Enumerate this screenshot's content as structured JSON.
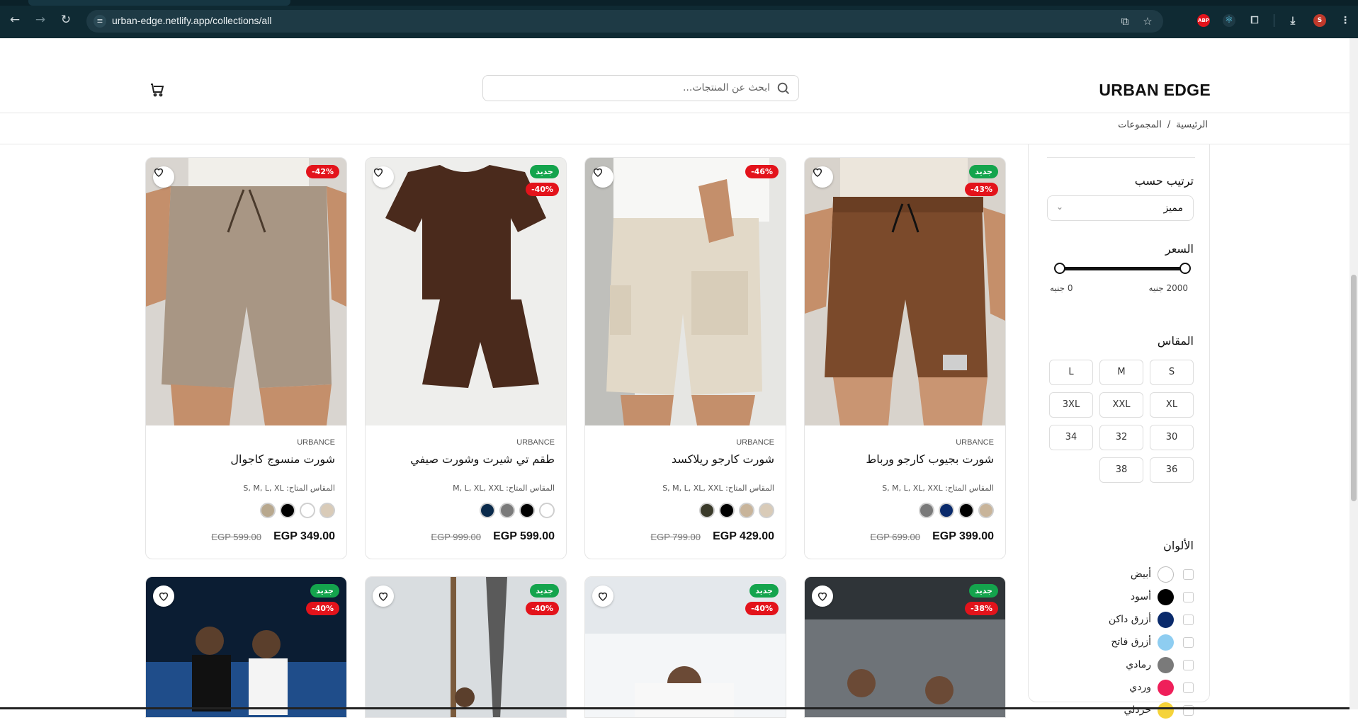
{
  "browser": {
    "url": "urban-edge.netlify.app/collections/all",
    "profile_initial": "S"
  },
  "header": {
    "logo": "URBAN EDGE",
    "search_placeholder": "ابحث عن المنتجات..."
  },
  "breadcrumb": {
    "home": "الرئيسية",
    "separator": "/",
    "current": "المجموعات"
  },
  "filters": {
    "sort_title": "ترتيب حسب",
    "sort_value": "مميز",
    "price_title": "السعر",
    "price_min_label": "0 جنيه",
    "price_max_label": "2000 جنيه",
    "size_title": "المقاس",
    "sizes": [
      "S",
      "M",
      "L",
      "XL",
      "XXL",
      "3XL",
      "30",
      "32",
      "34",
      "36",
      "38"
    ],
    "colors_title": "الألوان",
    "colors": [
      {
        "name": "أبيض",
        "hex": "#ffffff"
      },
      {
        "name": "أسود",
        "hex": "#000000"
      },
      {
        "name": "أزرق داكن",
        "hex": "#0a2a6b"
      },
      {
        "name": "أزرق فاتح",
        "hex": "#8ecdf1"
      },
      {
        "name": "رمادي",
        "hex": "#7a7a7a"
      },
      {
        "name": "وردي",
        "hex": "#ef1f5a"
      },
      {
        "name": "خردلي",
        "hex": "#f5d33a"
      }
    ]
  },
  "products": [
    {
      "brand": "URBANCE",
      "name": "شورت بجيوب كارجو ورباط",
      "sizes_label": "المقاس المتاح: S, M, L, XL, XXL",
      "colors": [
        "#c8b49a",
        "#000000",
        "#0a2a6b",
        "#7a7a7a"
      ],
      "price": "EGP 399.00",
      "old_price": "EGP 699.00",
      "badge_new": "جديد",
      "badge_discount": "-43%"
    },
    {
      "brand": "URBANCE",
      "name": "شورت كارجو ريلاكسد",
      "sizes_label": "المقاس المتاح: S, M, L, XL, XXL",
      "colors": [
        "#d9cbb8",
        "#c8b49a",
        "#000000",
        "#3a3a2a"
      ],
      "price": "EGP 429.00",
      "old_price": "EGP 799.00",
      "badge_new": "",
      "badge_discount": "-46%"
    },
    {
      "brand": "URBANCE",
      "name": "طقم تي شيرت وشورت صيفي",
      "sizes_label": "المقاس المتاح: M, L, XL, XXL",
      "colors": [
        "#ffffff",
        "#000000",
        "#7a7a7a",
        "#0a2a4b"
      ],
      "price": "EGP 599.00",
      "old_price": "EGP 999.00",
      "badge_new": "جديد",
      "badge_discount": "-40%"
    },
    {
      "brand": "URBANCE",
      "name": "شورت منسوج كاجوال",
      "sizes_label": "المقاس المتاح: S, M, L, XL",
      "colors": [
        "#d9cbb8",
        "#ffffff",
        "#000000",
        "#b8a88e"
      ],
      "price": "EGP 349.00",
      "old_price": "EGP 599.00",
      "badge_new": "",
      "badge_discount": "-42%"
    }
  ],
  "products_row2": [
    {
      "badge_new": "جديد",
      "badge_discount": "-38%"
    },
    {
      "badge_new": "جديد",
      "badge_discount": "-40%"
    },
    {
      "badge_new": "جديد",
      "badge_discount": "-40%"
    },
    {
      "badge_new": "جديد",
      "badge_discount": "-40%"
    }
  ]
}
